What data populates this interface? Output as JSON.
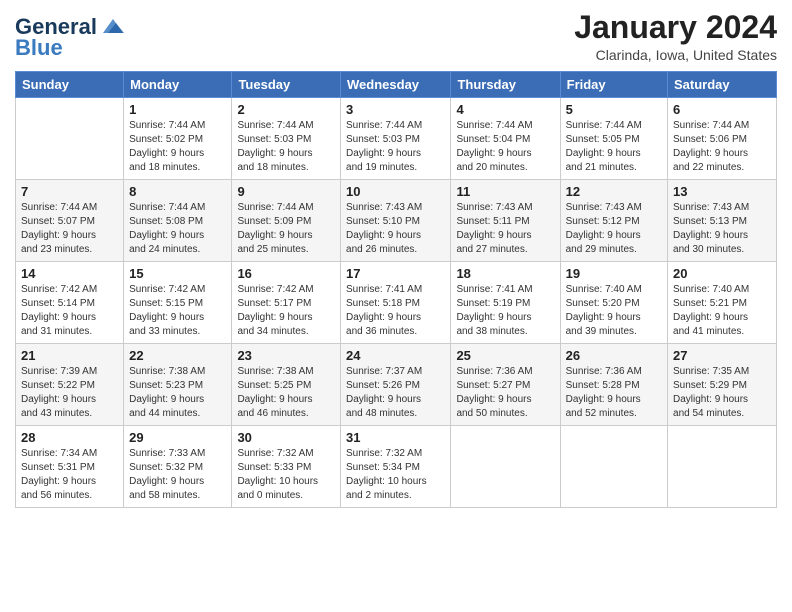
{
  "header": {
    "logo_line1": "General",
    "logo_line2": "Blue",
    "month_title": "January 2024",
    "location": "Clarinda, Iowa, United States"
  },
  "weekdays": [
    "Sunday",
    "Monday",
    "Tuesday",
    "Wednesday",
    "Thursday",
    "Friday",
    "Saturday"
  ],
  "weeks": [
    [
      {
        "day": "",
        "info": ""
      },
      {
        "day": "1",
        "info": "Sunrise: 7:44 AM\nSunset: 5:02 PM\nDaylight: 9 hours\nand 18 minutes."
      },
      {
        "day": "2",
        "info": "Sunrise: 7:44 AM\nSunset: 5:03 PM\nDaylight: 9 hours\nand 18 minutes."
      },
      {
        "day": "3",
        "info": "Sunrise: 7:44 AM\nSunset: 5:03 PM\nDaylight: 9 hours\nand 19 minutes."
      },
      {
        "day": "4",
        "info": "Sunrise: 7:44 AM\nSunset: 5:04 PM\nDaylight: 9 hours\nand 20 minutes."
      },
      {
        "day": "5",
        "info": "Sunrise: 7:44 AM\nSunset: 5:05 PM\nDaylight: 9 hours\nand 21 minutes."
      },
      {
        "day": "6",
        "info": "Sunrise: 7:44 AM\nSunset: 5:06 PM\nDaylight: 9 hours\nand 22 minutes."
      }
    ],
    [
      {
        "day": "7",
        "info": "Sunrise: 7:44 AM\nSunset: 5:07 PM\nDaylight: 9 hours\nand 23 minutes."
      },
      {
        "day": "8",
        "info": "Sunrise: 7:44 AM\nSunset: 5:08 PM\nDaylight: 9 hours\nand 24 minutes."
      },
      {
        "day": "9",
        "info": "Sunrise: 7:44 AM\nSunset: 5:09 PM\nDaylight: 9 hours\nand 25 minutes."
      },
      {
        "day": "10",
        "info": "Sunrise: 7:43 AM\nSunset: 5:10 PM\nDaylight: 9 hours\nand 26 minutes."
      },
      {
        "day": "11",
        "info": "Sunrise: 7:43 AM\nSunset: 5:11 PM\nDaylight: 9 hours\nand 27 minutes."
      },
      {
        "day": "12",
        "info": "Sunrise: 7:43 AM\nSunset: 5:12 PM\nDaylight: 9 hours\nand 29 minutes."
      },
      {
        "day": "13",
        "info": "Sunrise: 7:43 AM\nSunset: 5:13 PM\nDaylight: 9 hours\nand 30 minutes."
      }
    ],
    [
      {
        "day": "14",
        "info": "Sunrise: 7:42 AM\nSunset: 5:14 PM\nDaylight: 9 hours\nand 31 minutes."
      },
      {
        "day": "15",
        "info": "Sunrise: 7:42 AM\nSunset: 5:15 PM\nDaylight: 9 hours\nand 33 minutes."
      },
      {
        "day": "16",
        "info": "Sunrise: 7:42 AM\nSunset: 5:17 PM\nDaylight: 9 hours\nand 34 minutes."
      },
      {
        "day": "17",
        "info": "Sunrise: 7:41 AM\nSunset: 5:18 PM\nDaylight: 9 hours\nand 36 minutes."
      },
      {
        "day": "18",
        "info": "Sunrise: 7:41 AM\nSunset: 5:19 PM\nDaylight: 9 hours\nand 38 minutes."
      },
      {
        "day": "19",
        "info": "Sunrise: 7:40 AM\nSunset: 5:20 PM\nDaylight: 9 hours\nand 39 minutes."
      },
      {
        "day": "20",
        "info": "Sunrise: 7:40 AM\nSunset: 5:21 PM\nDaylight: 9 hours\nand 41 minutes."
      }
    ],
    [
      {
        "day": "21",
        "info": "Sunrise: 7:39 AM\nSunset: 5:22 PM\nDaylight: 9 hours\nand 43 minutes."
      },
      {
        "day": "22",
        "info": "Sunrise: 7:38 AM\nSunset: 5:23 PM\nDaylight: 9 hours\nand 44 minutes."
      },
      {
        "day": "23",
        "info": "Sunrise: 7:38 AM\nSunset: 5:25 PM\nDaylight: 9 hours\nand 46 minutes."
      },
      {
        "day": "24",
        "info": "Sunrise: 7:37 AM\nSunset: 5:26 PM\nDaylight: 9 hours\nand 48 minutes."
      },
      {
        "day": "25",
        "info": "Sunrise: 7:36 AM\nSunset: 5:27 PM\nDaylight: 9 hours\nand 50 minutes."
      },
      {
        "day": "26",
        "info": "Sunrise: 7:36 AM\nSunset: 5:28 PM\nDaylight: 9 hours\nand 52 minutes."
      },
      {
        "day": "27",
        "info": "Sunrise: 7:35 AM\nSunset: 5:29 PM\nDaylight: 9 hours\nand 54 minutes."
      }
    ],
    [
      {
        "day": "28",
        "info": "Sunrise: 7:34 AM\nSunset: 5:31 PM\nDaylight: 9 hours\nand 56 minutes."
      },
      {
        "day": "29",
        "info": "Sunrise: 7:33 AM\nSunset: 5:32 PM\nDaylight: 9 hours\nand 58 minutes."
      },
      {
        "day": "30",
        "info": "Sunrise: 7:32 AM\nSunset: 5:33 PM\nDaylight: 10 hours\nand 0 minutes."
      },
      {
        "day": "31",
        "info": "Sunrise: 7:32 AM\nSunset: 5:34 PM\nDaylight: 10 hours\nand 2 minutes."
      },
      {
        "day": "",
        "info": ""
      },
      {
        "day": "",
        "info": ""
      },
      {
        "day": "",
        "info": ""
      }
    ]
  ]
}
